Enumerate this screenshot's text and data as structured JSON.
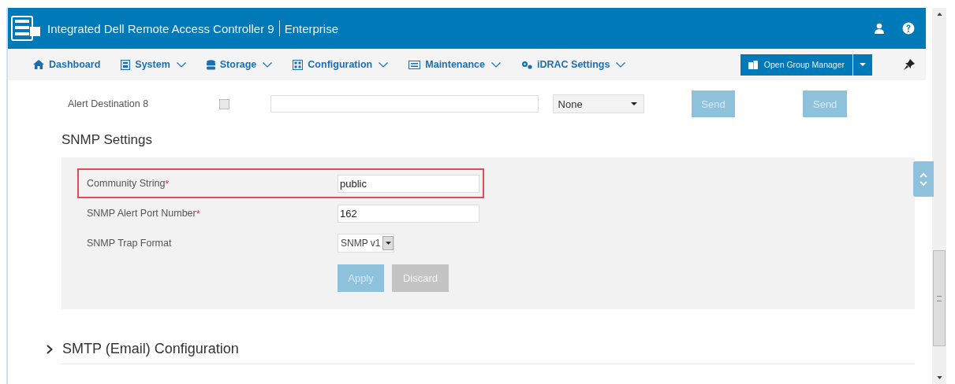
{
  "header": {
    "title": "Integrated Dell Remote Access Controller 9",
    "edition": "Enterprise"
  },
  "nav": {
    "items": [
      {
        "label": "Dashboard",
        "dropdown": false
      },
      {
        "label": "System",
        "dropdown": true
      },
      {
        "label": "Storage",
        "dropdown": true
      },
      {
        "label": "Configuration",
        "dropdown": true
      },
      {
        "label": "Maintenance",
        "dropdown": true
      },
      {
        "label": "iDRAC Settings",
        "dropdown": true
      }
    ],
    "group_button": "Open Group Manager"
  },
  "alert_row": {
    "label": "Alert Destination 8",
    "checked": false,
    "select": "None",
    "buttons": [
      {
        "label": "Send",
        "disabled": true
      },
      {
        "label": "Send",
        "disabled": true
      }
    ]
  },
  "snmp": {
    "title": "SNMP Settings",
    "fields": [
      {
        "label": "Community String",
        "required_mark": "*",
        "kind": "text",
        "value": "public",
        "highlighted": true
      },
      {
        "label": "SNMP Alert Port Number",
        "required_mark": "*",
        "kind": "text",
        "value": "162",
        "highlighted": false
      },
      {
        "label": "SNMP Trap Format",
        "kind": "select",
        "value": "SNMP v1",
        "highlighted": false
      }
    ],
    "buttons": [
      {
        "label": "Apply",
        "kind": "primary",
        "disabled": true
      },
      {
        "label": "Discard",
        "kind": "secondary",
        "disabled": true
      }
    ]
  },
  "smtp": {
    "title": "SMTP (Email) Configuration",
    "expanded": false
  }
}
